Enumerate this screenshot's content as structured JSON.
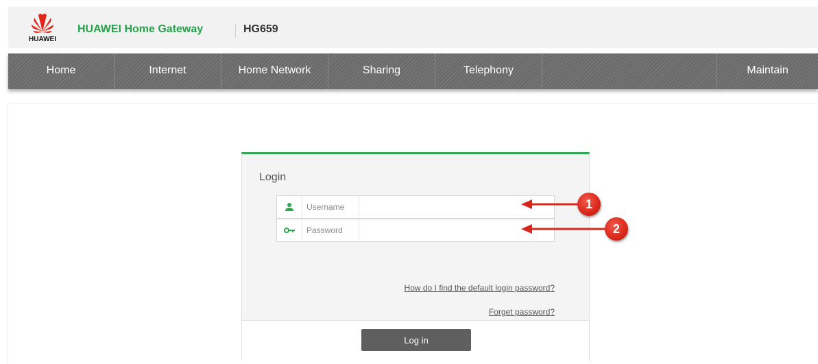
{
  "header": {
    "logo_text": "HUAWEI",
    "title": "HUAWEI Home Gateway",
    "model": "HG659"
  },
  "nav": {
    "items": [
      {
        "label": "Home"
      },
      {
        "label": "Internet"
      },
      {
        "label": "Home Network"
      },
      {
        "label": "Sharing"
      },
      {
        "label": "Telephony"
      },
      {
        "label": "Maintain"
      }
    ]
  },
  "login": {
    "title": "Login",
    "username_label": "Username",
    "username_value": "",
    "password_label": "Password",
    "password_value": "",
    "default_password_link": "How do I find the default login password?",
    "forget_password_link": "Forget password?",
    "login_button": "Log in"
  },
  "annotations": {
    "badge_1": "1",
    "badge_2": "2"
  },
  "colors": {
    "brand_green": "#27a24c",
    "nav_gray": "#6e6e6e",
    "annotation_red": "#d9261a"
  },
  "icons": {
    "logo": "huawei-petal-logo",
    "username": "user-icon",
    "password": "key-icon"
  }
}
